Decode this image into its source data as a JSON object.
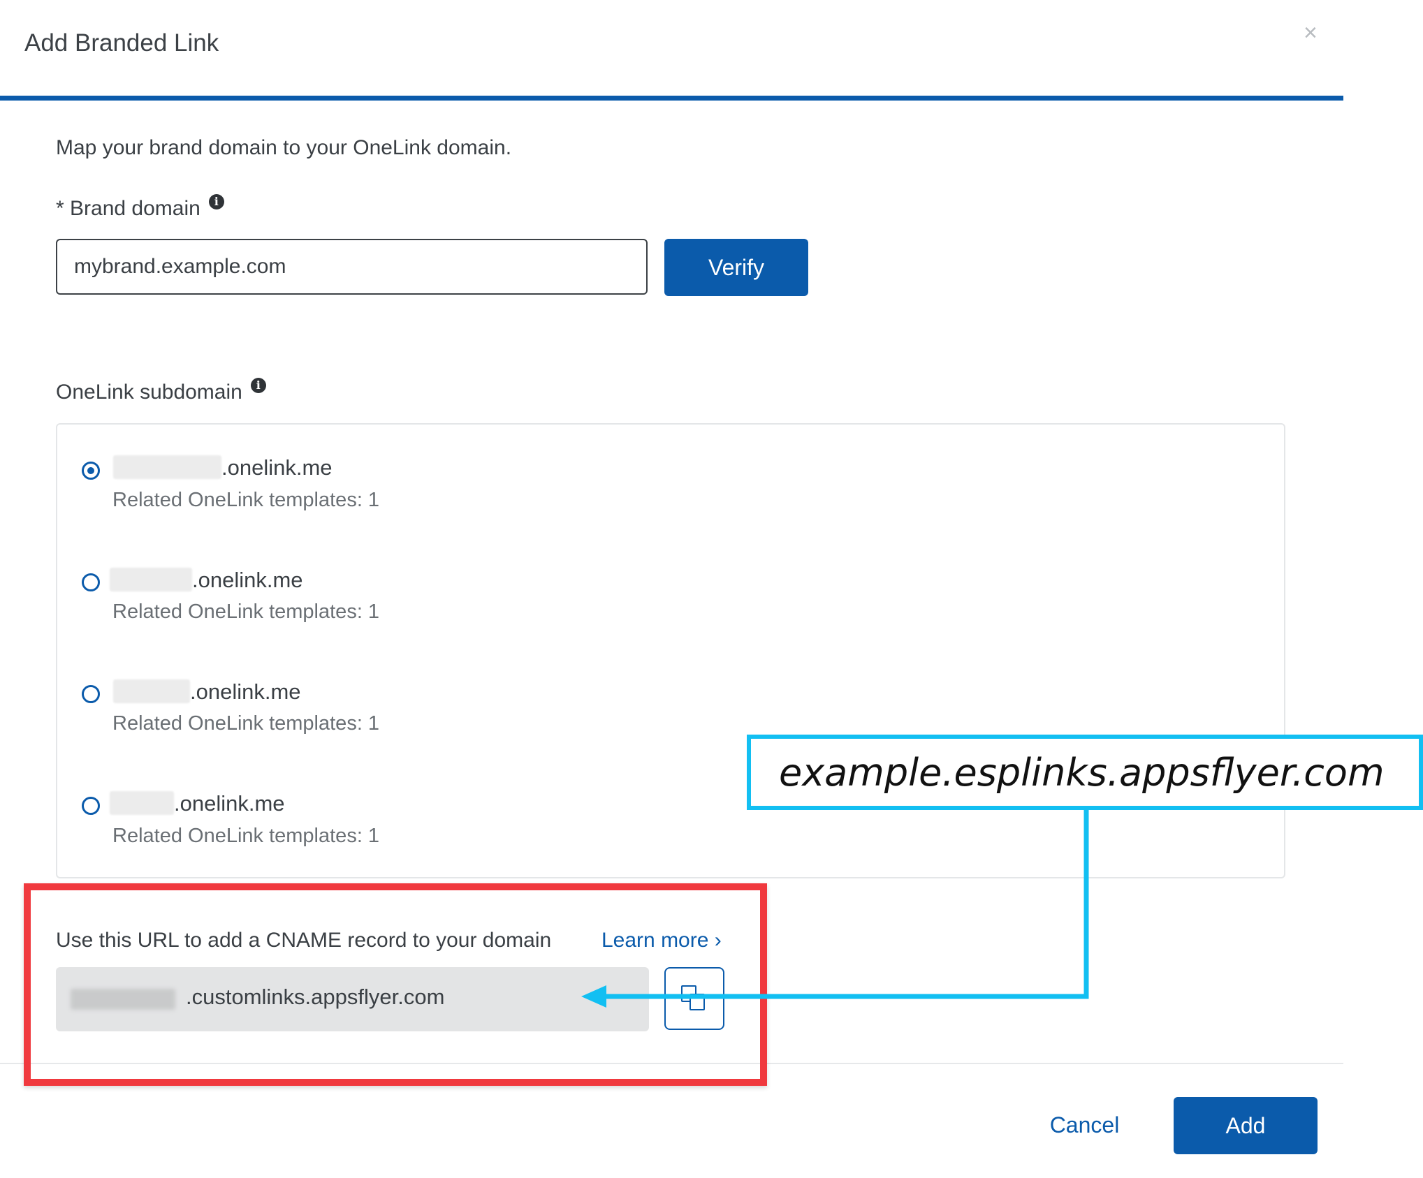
{
  "dialog": {
    "title": "Add Branded Link",
    "close_glyph": "×"
  },
  "intro": "Map your brand domain to your OneLink domain.",
  "brand_domain": {
    "label": "* Brand domain",
    "value": "mybrand.example.com",
    "info_icon": "info-icon",
    "verify_label": "Verify"
  },
  "subdomain": {
    "label": "OneLink subdomain",
    "items": [
      {
        "suffix": ".onelink.me",
        "meta": "Related OneLink templates: 1",
        "selected": true
      },
      {
        "suffix": ".onelink.me",
        "meta": "Related OneLink templates: 1",
        "selected": false
      },
      {
        "suffix": ".onelink.me",
        "meta": "Related OneLink templates: 1",
        "selected": false
      },
      {
        "suffix": ".onelink.me",
        "meta": "Related OneLink templates: 1",
        "selected": false
      }
    ]
  },
  "cname": {
    "label": "Use this URL to add a CNAME record to your domain",
    "learn_more": "Learn more ›",
    "value": ".customlinks.appsflyer.com",
    "copy_icon": "copy-icon"
  },
  "footer": {
    "cancel_label": "Cancel",
    "add_label": "Add"
  },
  "annotation": {
    "callout_text": "example.esplinks.appsflyer.com",
    "callout_color": "#12bff2",
    "highlight_color": "#f0393e"
  },
  "colors": {
    "primary": "#0b5bab",
    "text": "#3a3f44"
  }
}
